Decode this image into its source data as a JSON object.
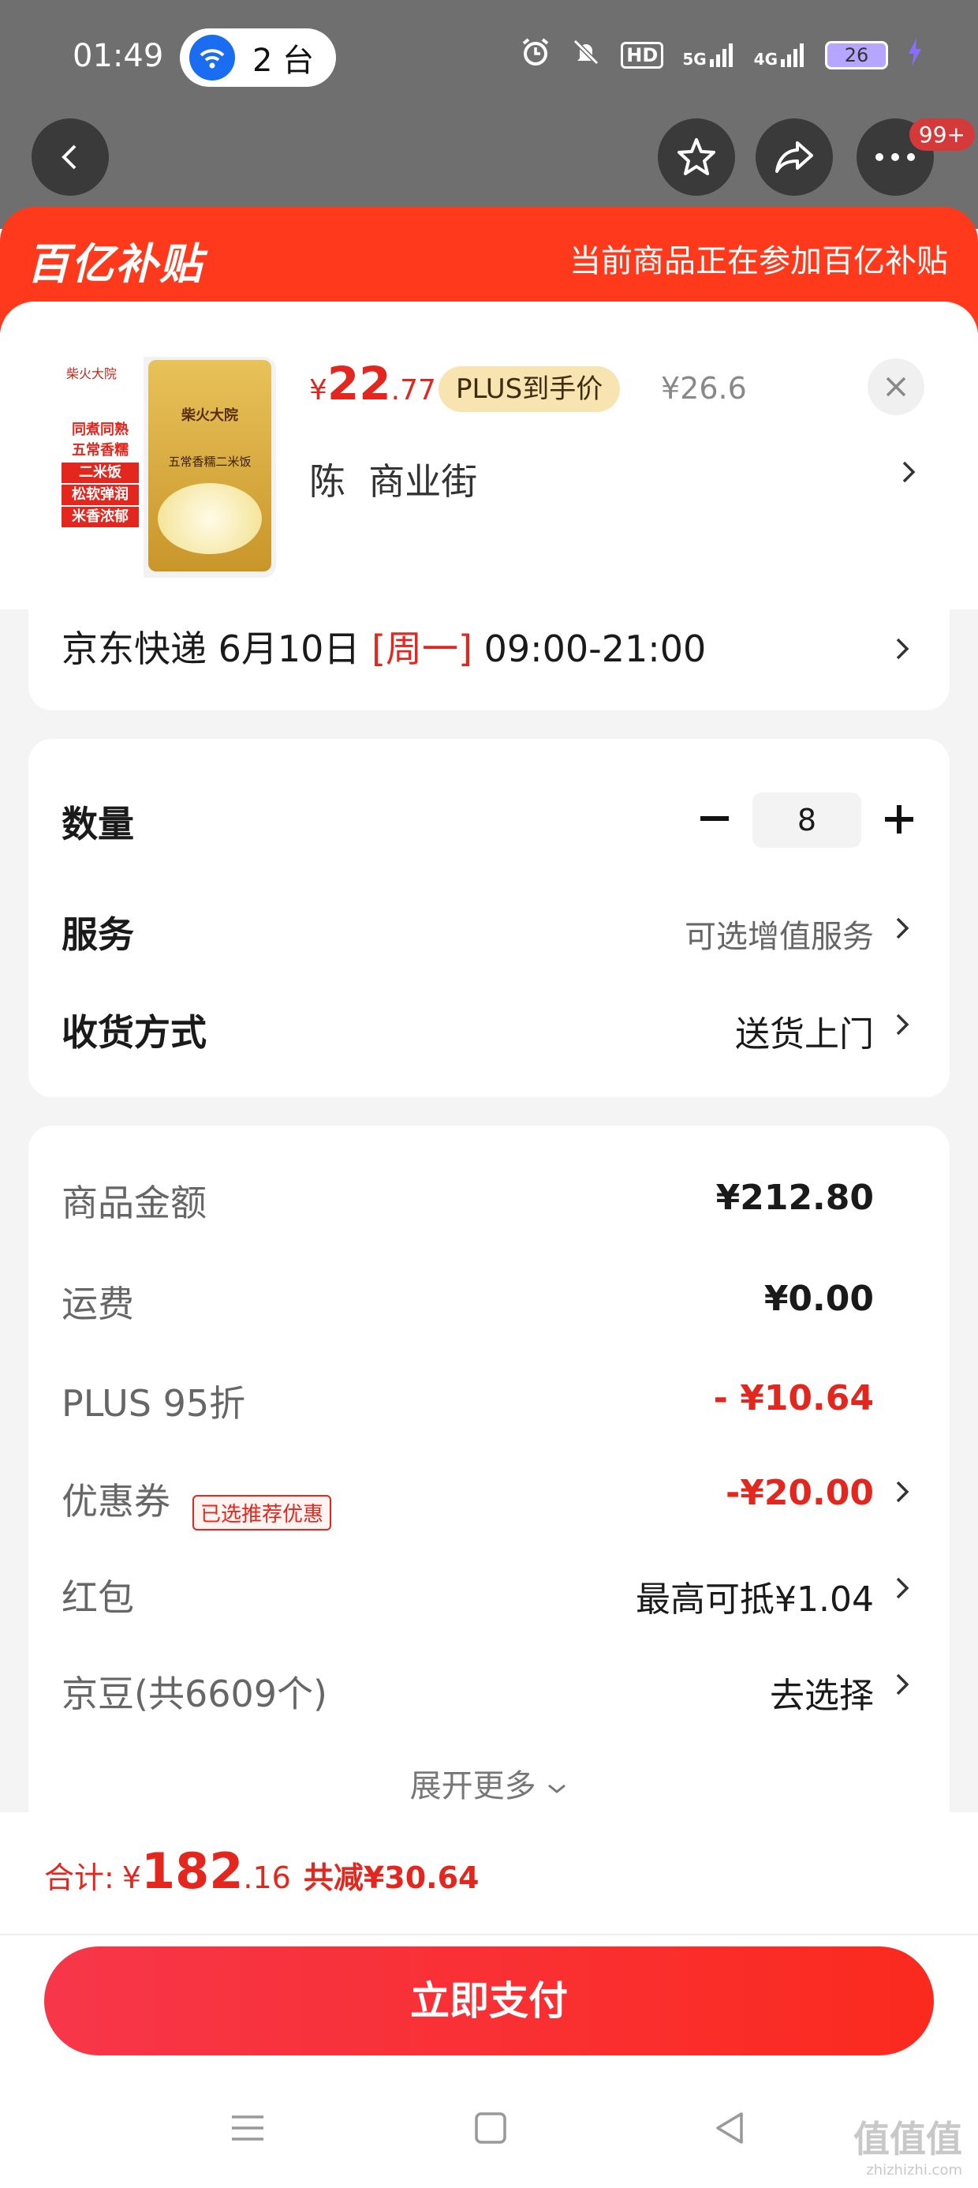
{
  "status_bar": {
    "time": "01:49",
    "hotspot_label": "2 台",
    "battery": "26",
    "net1": "5G",
    "net2": "4G",
    "hd": "HD",
    "more_badge": "99+"
  },
  "banner": {
    "logo": "百亿补贴",
    "notice": "当前商品正在参加百亿补贴"
  },
  "product": {
    "image_texts": {
      "brand": "柴火大院",
      "tag1": "同煮同熟",
      "tag2": "五常香糯",
      "tag3": "二米饭",
      "tag4": "松软弹润",
      "tag5": "米香浓郁",
      "bag_title": "五常香糯二米饭"
    },
    "price_symbol": "¥",
    "price_int": "22",
    "price_dec": ".77",
    "plus_tag": "PLUS到手价",
    "original_price": "¥26.6",
    "address": "陈  商业街"
  },
  "delivery": {
    "carrier": "京东快递",
    "date": "6月10日",
    "weekday": "[周一]",
    "time": "09:00-21:00"
  },
  "options": {
    "quantity_label": "数量",
    "quantity": "8",
    "service_label": "服务",
    "service_value": "可选增值服务",
    "method_label": "收货方式",
    "method_value": "送货上门"
  },
  "costs": {
    "goods_label": "商品金额",
    "goods_value": "¥212.80",
    "freight_label": "运费",
    "freight_value": "¥0.00",
    "plus_label": "PLUS 95折",
    "plus_value": "- ¥10.64",
    "coupon_label": "优惠券",
    "coupon_badge": "已选推荐优惠",
    "coupon_value": "-¥20.00",
    "redpacket_label": "红包",
    "redpacket_value": "最高可抵¥1.04",
    "jingdou_label": "京豆(共6609个)",
    "jingdou_value": "去选择",
    "expand": "展开更多"
  },
  "footer": {
    "total_label": "合计:",
    "total_symbol": "¥",
    "total_int": "182",
    "total_dec": ".16",
    "saved": "共减¥30.64",
    "pay_button": "立即支付"
  },
  "watermark": {
    "main": "值值值",
    "sub": "zhizhizhi.com"
  },
  "colors": {
    "brand_red": "#e4271e",
    "banner_red": "#ff3a1c",
    "plus_gold": "#f8e4b0"
  }
}
